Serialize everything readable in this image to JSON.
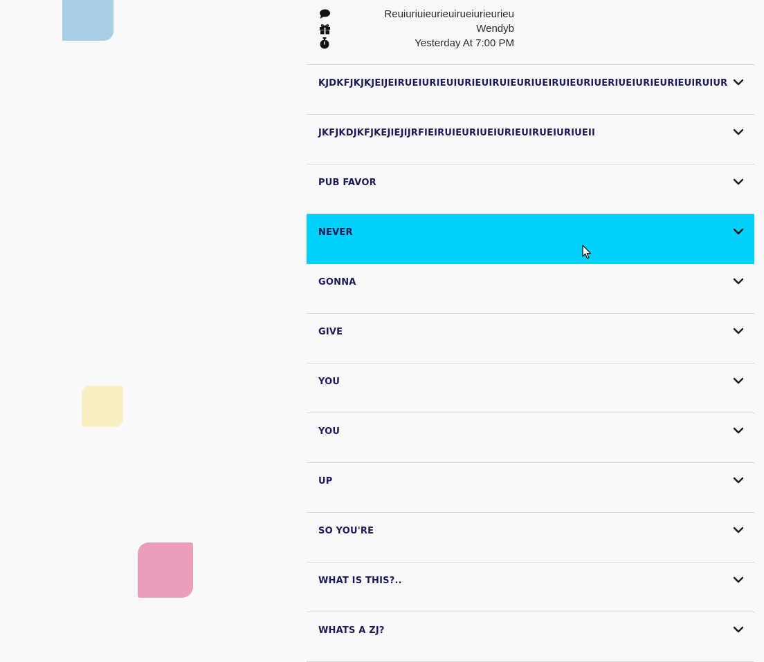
{
  "post": {
    "comment_icon": "comment-icon",
    "comment_text": "Reuiuriuieurieuirueiurieurieu",
    "gift_icon": "gift-icon",
    "author": "Wendyb",
    "timer_icon": "stopwatch-icon",
    "time": "Yesterday At 7:00 PM"
  },
  "accordion": {
    "items": [
      {
        "label": "KJDKFJKJKJEIJEIRUEIURIEUIURIEUIRUIEURIUEIRUIEURIUERIUEIURIEURIEUIRUIUR",
        "expanded": false
      },
      {
        "label": "JKFJKDJKFJKEJIEJIJRFIEIRUIEURIUEIURIEUIRUEIURIUEII",
        "expanded": false
      },
      {
        "label": "PUB FAVOR",
        "expanded": false
      },
      {
        "label": "NEVER",
        "expanded": false,
        "hovered": true
      },
      {
        "label": "GONNA",
        "expanded": false
      },
      {
        "label": "GIVE",
        "expanded": false
      },
      {
        "label": "YOU",
        "expanded": false
      },
      {
        "label": "YOU",
        "expanded": false
      },
      {
        "label": "UP",
        "expanded": false
      },
      {
        "label": "SO YOU'RE",
        "expanded": false
      },
      {
        "label": "WHAT IS THIS?..",
        "expanded": false
      },
      {
        "label": "WHATS A ZJ?",
        "expanded": false
      }
    ],
    "chevron_icon": "chevron-down-icon"
  },
  "colors": {
    "background": "#f9f9fb",
    "label_text": "#1c1a56",
    "active_row": "#00d0fa",
    "divider": "#d4d4d8",
    "deco_blue": "#a8cfe6",
    "deco_yellow": "#f8efc3",
    "deco_pink": "#e99fbc"
  }
}
